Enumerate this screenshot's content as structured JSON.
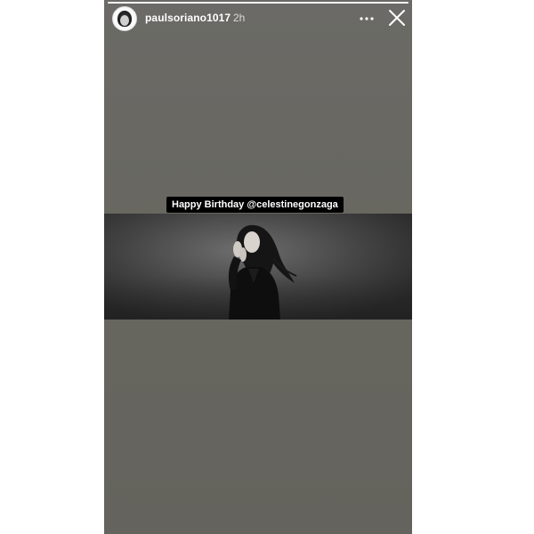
{
  "story": {
    "progress_fraction": 1.0,
    "username": "paulsoriano1017",
    "time": "2h",
    "more_icon": "more-horizontal-icon",
    "close_icon": "close-icon",
    "caption": {
      "prefix": "Happy Birthday ",
      "mention": "@celestinegonzaga"
    },
    "photo": {
      "description_icon": "photo-image"
    },
    "colors": {
      "background": "#67665f",
      "caption_bg": "#000000",
      "text": "#ffffff"
    }
  }
}
